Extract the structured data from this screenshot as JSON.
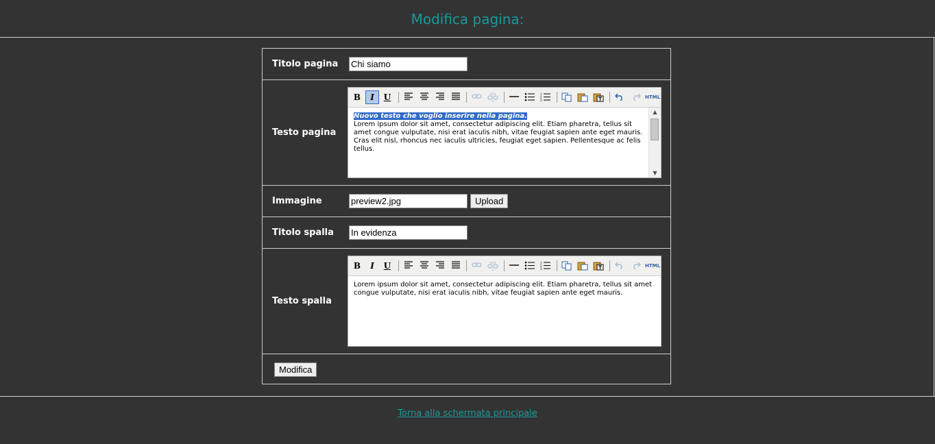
{
  "header": {
    "title": "Modifica pagina:"
  },
  "form": {
    "titolo_pagina": {
      "label": "Titolo pagina",
      "value": "Chi siamo"
    },
    "testo_pagina": {
      "label": "Testo pagina",
      "highlighted_text": "Nuovo testo che voglio inserire nella pagina.",
      "body_text": "Lorem ipsum dolor sit amet, consectetur adipiscing elit. Etiam pharetra, tellus sit amet congue vulputate, nisi erat iaculis nibh, vitae feugiat sapien ante eget mauris. Cras elit nisl, rhoncus nec iaculis ultricies, feugiat eget sapien. Pellentesque ac felis tellus."
    },
    "immagine": {
      "label": "Immagine",
      "value": "preview2.jpg",
      "upload_label": "Upload"
    },
    "titolo_spalla": {
      "label": "Titolo spalla",
      "value": "In evidenza"
    },
    "testo_spalla": {
      "label": "Testo spalla",
      "body_text": "Lorem ipsum dolor sit amet, consectetur adipiscing elit. Etiam pharetra, tellus sit amet congue vulputate, nisi erat iaculis nibh, vitae feugiat sapien ante eget mauris."
    },
    "submit_label": "Modifica"
  },
  "toolbar": {
    "bold": "B",
    "italic": "I",
    "underline": "U",
    "html": "HTML",
    "icons": [
      "bold-icon",
      "italic-icon",
      "underline-icon",
      "align-left-icon",
      "align-center-icon",
      "align-right-icon",
      "align-justify-icon",
      "link-icon",
      "unlink-icon",
      "horizontal-rule-icon",
      "bullet-list-icon",
      "numbered-list-icon",
      "copy-icon",
      "paste-icon",
      "paste-text-icon",
      "undo-icon",
      "redo-icon",
      "html-source-icon"
    ]
  },
  "footer": {
    "back_link": "Torna alla schermata principale"
  },
  "colors": {
    "background": "#333333",
    "accent": "#1a9a9a",
    "selection": "#316ac5"
  }
}
